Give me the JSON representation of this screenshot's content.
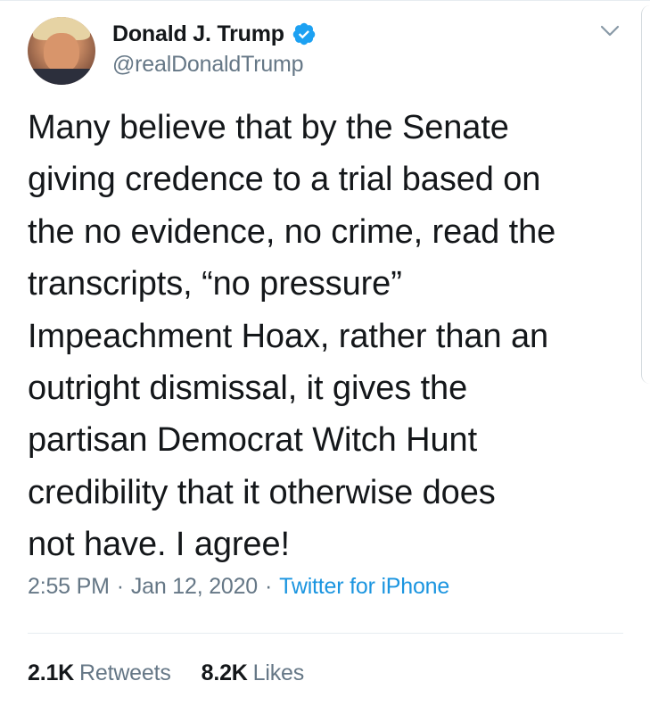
{
  "author": {
    "display_name": "Donald J. Trump",
    "handle": "@realDonaldTrump",
    "verified": true,
    "avatar_icon": "profile-photo"
  },
  "tweet": {
    "lines": [
      "Many believe that by the Senate",
      "giving credence to a trial based on",
      "the no evidence, no crime, read the",
      "transcripts, “no pressure”",
      "Impeachment Hoax, rather than an",
      "outright dismissal, it gives the",
      "partisan Democrat Witch Hunt",
      "credibility that it otherwise does",
      "not have. I agree!"
    ]
  },
  "meta": {
    "time": "2:55 PM",
    "date": "Jan 12, 2020",
    "separator": "·",
    "source": "Twitter for iPhone"
  },
  "stats": {
    "retweets_count": "2.1K",
    "retweets_label": "Retweets",
    "likes_count": "8.2K",
    "likes_label": "Likes"
  },
  "icons": {
    "verified": "verified-badge-icon",
    "menu": "chevron-down-icon"
  },
  "colors": {
    "text_primary": "#14171a",
    "text_secondary": "#657786",
    "link": "#1b95e0",
    "verified": "#1da1f2",
    "divider": "#e6ecf0"
  }
}
